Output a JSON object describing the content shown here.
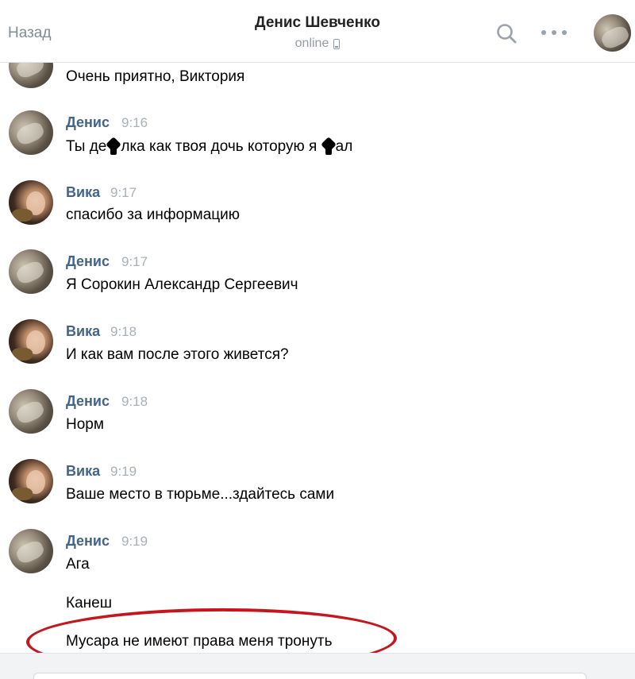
{
  "header": {
    "back_label": "Назад",
    "title": "Денис Шевченко",
    "status": "online"
  },
  "messages": [
    {
      "text": "Очень приятно, Виктория"
    },
    {
      "sender": "Денис",
      "time": "9:16",
      "text_before": "Ты де",
      "text_middle": "лка как твоя дочь которую я",
      "text_after": "ал"
    },
    {
      "sender": "Вика",
      "time": "9:17",
      "text": "спасибо за информацию"
    },
    {
      "sender": "Денис",
      "time": "9:17",
      "text": "Я Сорокин Александр Сергеевич"
    },
    {
      "sender": "Вика",
      "time": "9:18",
      "text": "И как вам после этого живется?"
    },
    {
      "sender": "Денис",
      "time": "9:18",
      "text": "Норм"
    },
    {
      "sender": "Вика",
      "time": "9:19",
      "text": "Ваше место в тюрьме...здайтесь сами"
    },
    {
      "sender": "Денис",
      "time": "9:19",
      "text": "Ага"
    },
    {
      "text": "Канеш"
    },
    {
      "text": "Мусара не имеют права меня тронуть"
    }
  ],
  "colors": {
    "sender_name": "#42648b",
    "time": "#a8b0ba",
    "highlight": "#c4161c"
  },
  "icons": [
    "phone-icon",
    "search-icon",
    "more-icon",
    "avatar"
  ]
}
